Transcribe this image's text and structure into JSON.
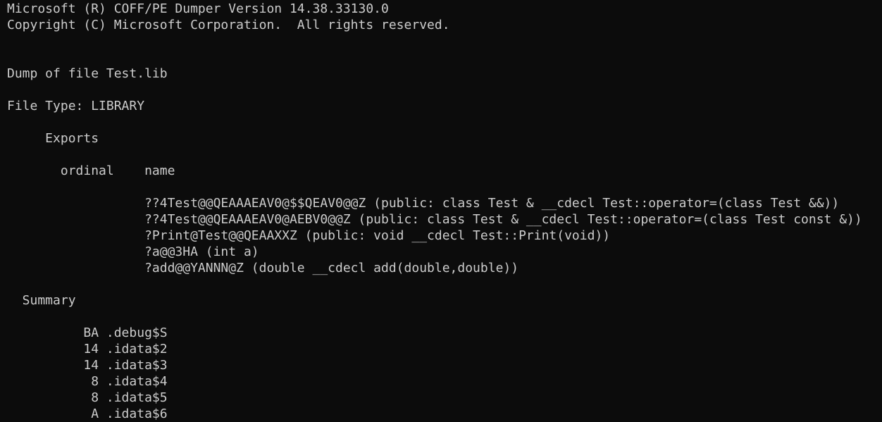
{
  "terminal": {
    "background": "#0c0c0c",
    "foreground": "#cccccc",
    "lines": [
      "Microsoft (R) COFF/PE Dumper Version 14.38.33130.0",
      "Copyright (C) Microsoft Corporation.  All rights reserved.",
      "",
      "",
      "Dump of file Test.lib",
      "",
      "File Type: LIBRARY",
      "",
      "     Exports",
      "",
      "       ordinal    name",
      "",
      "                  ??4Test@@QEAAAEAV0@$$QEAV0@@Z (public: class Test & __cdecl Test::operator=(class Test &&))",
      "                  ??4Test@@QEAAAEAV0@AEBV0@@Z (public: class Test & __cdecl Test::operator=(class Test const &))",
      "                  ?Print@Test@@QEAAXXZ (public: void __cdecl Test::Print(void))",
      "                  ?a@@3HA (int a)",
      "                  ?add@@YANNN@Z (double __cdecl add(double,double))",
      "",
      "  Summary",
      "",
      "          BA .debug$S",
      "          14 .idata$2",
      "          14 .idata$3",
      "           8 .idata$4",
      "           8 .idata$5",
      "           A .idata$6"
    ]
  }
}
